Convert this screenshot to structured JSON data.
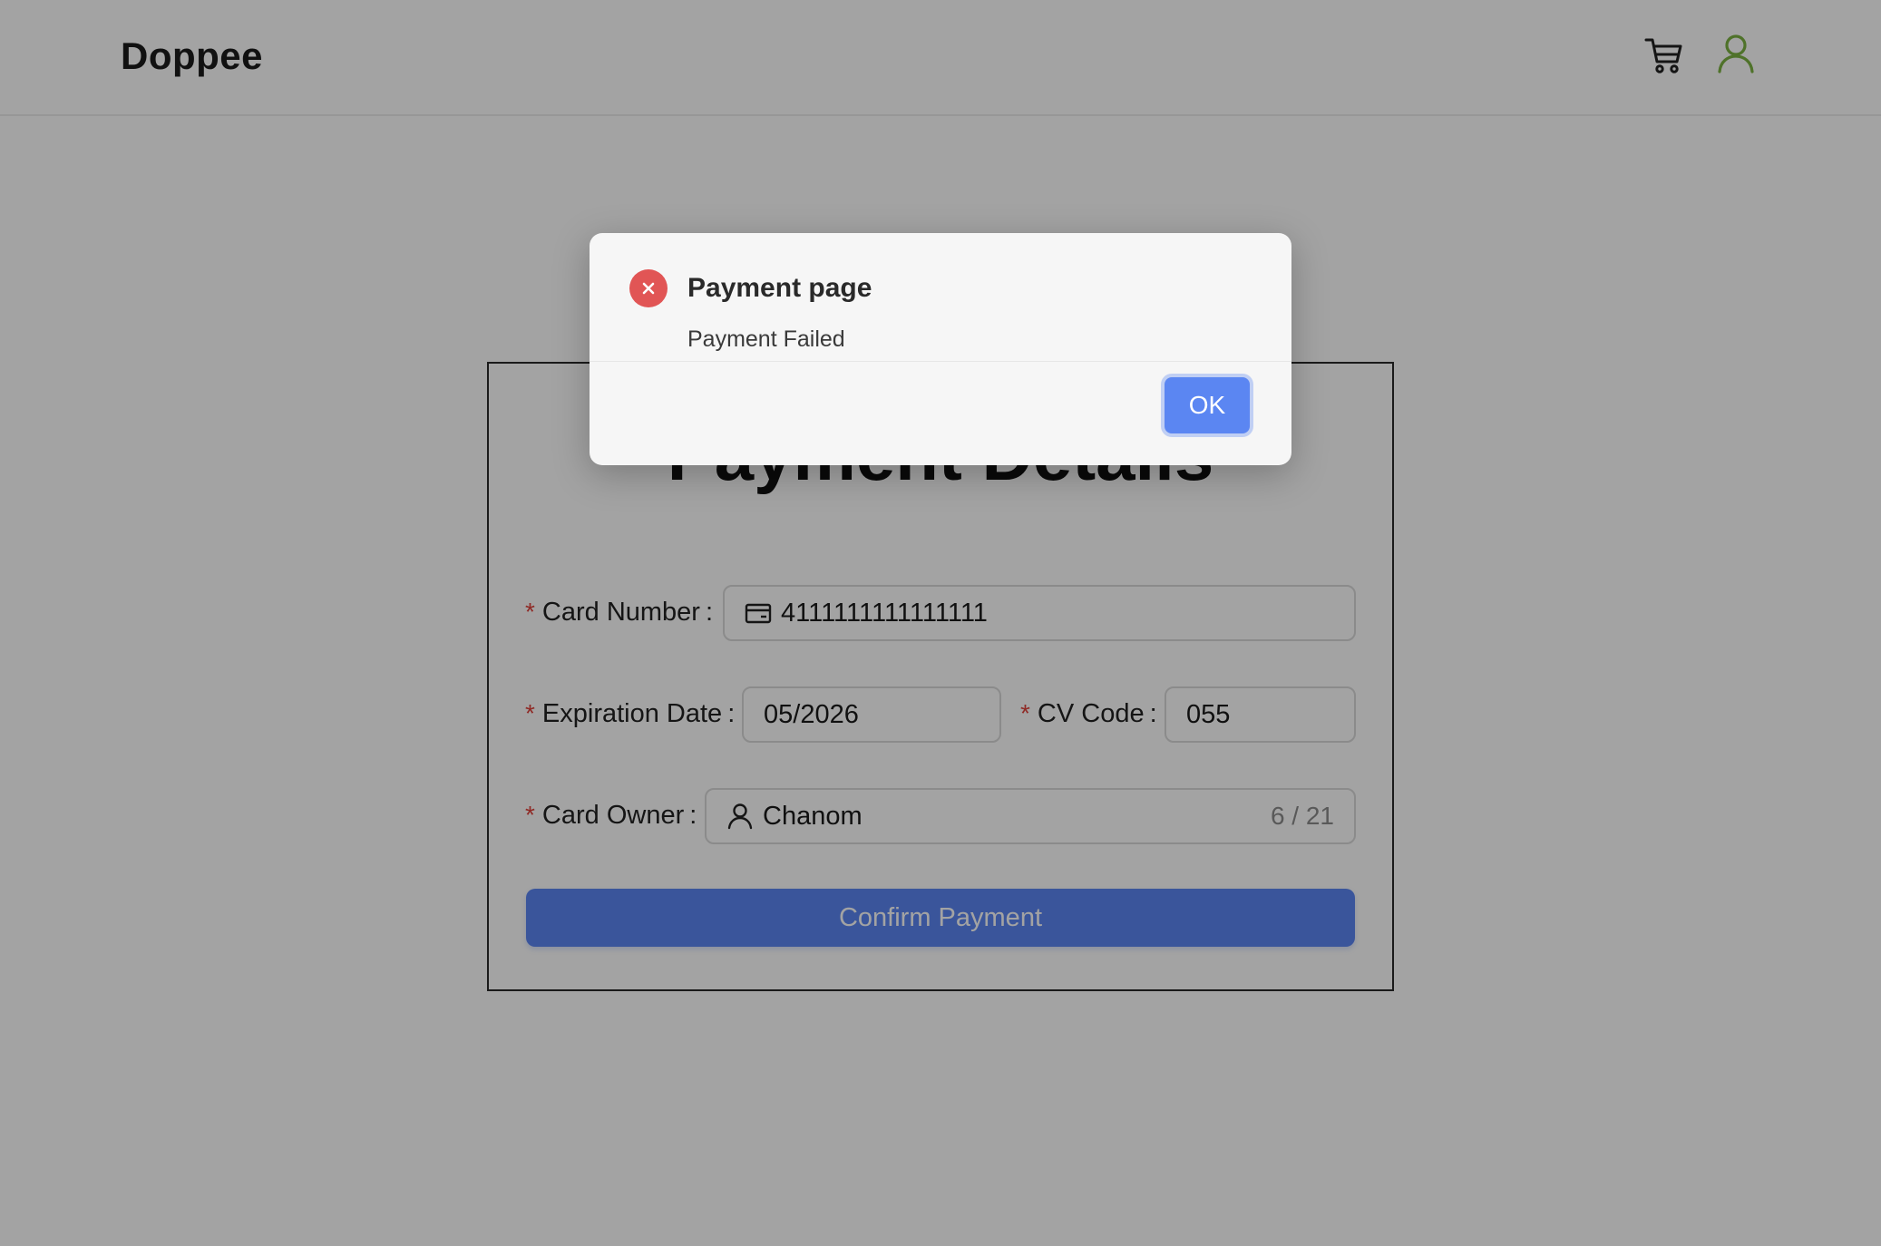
{
  "header": {
    "logo": "Doppee",
    "cart_icon": "shopping-cart-icon",
    "user_icon": "user-icon",
    "user_icon_color": "#7cb342"
  },
  "payment_form": {
    "title": "Payment Details",
    "card_number": {
      "label": "Card Number",
      "value": "4111111111111111",
      "icon": "credit-card-icon"
    },
    "expiration_date": {
      "label": "Expiration Date",
      "value": "05/2026"
    },
    "cv_code": {
      "label": "CV Code",
      "value": "055"
    },
    "card_owner": {
      "label": "Card Owner",
      "value": "Chanom",
      "icon": "user-icon",
      "counter": "6 / 21"
    },
    "required_mark": "*",
    "colon": ":",
    "confirm_button": "Confirm Payment"
  },
  "modal": {
    "icon": "error-circle-icon",
    "title": "Payment page",
    "message": "Payment Failed",
    "ok_button": "OK"
  },
  "colors": {
    "primary": "#5b86f2",
    "error": "#e15555",
    "required": "#e0433c"
  }
}
